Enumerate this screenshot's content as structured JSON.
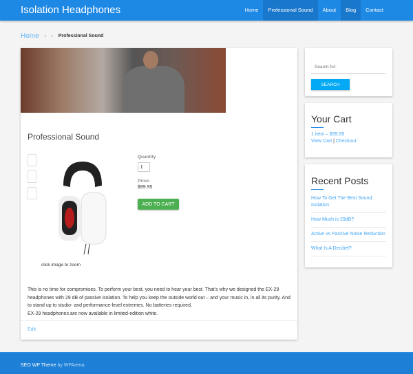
{
  "header": {
    "site_title": "Isolation Headphones",
    "nav": [
      {
        "label": "Home"
      },
      {
        "label": "Professional Sound",
        "active": true
      },
      {
        "label": "About"
      },
      {
        "label": "Blog"
      },
      {
        "label": "Contact"
      }
    ]
  },
  "breadcrumb": {
    "home": "Home",
    "sep": "›",
    "current": "Professional Sound"
  },
  "product": {
    "title": "Professional Sound",
    "zoom_hint": "click image to zoom",
    "quantity_label": "Quantity",
    "quantity": "1",
    "price_label": "Price:",
    "price": "$99.95",
    "add_to_cart": "ADD TO CART",
    "description": "This is no time for compromises. To perform your best, you need to hear your best. That’s why we designed the EX-29 headphones with 29 dB of passive isolation. To help you keep the outside world out – and your music in, in all its purity. And to stand up to studio- and performance-level extremes. No batteries required.",
    "description2": "EX-29 headphones are now available in limited-edition white.",
    "edit": "Edit"
  },
  "sidebar": {
    "search": {
      "placeholder": "Search for:",
      "button": "SEARCH"
    },
    "cart": {
      "title": "Your Cart",
      "summary": "1 item – $99.95",
      "view_cart": "View Cart",
      "sep": "|",
      "checkout": "Checkout"
    },
    "recent": {
      "title": "Recent Posts",
      "posts": [
        "How To Get The Best Sound Isolation",
        "How Much is 29dB?",
        "Active vs Passive Noise Reduction",
        "What Is A Decibel?"
      ]
    }
  },
  "footer": {
    "theme": "SEO WP Theme",
    "by": "by WPArena."
  },
  "colors": {
    "primary": "#1e88e5",
    "cart_button": "#4caf50",
    "search_button": "#03a9f4",
    "link": "#42a5f5"
  }
}
